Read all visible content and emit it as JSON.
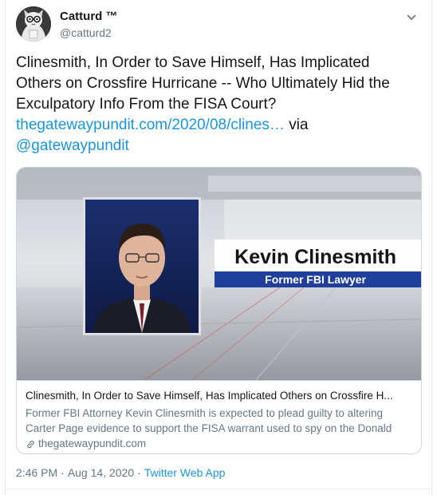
{
  "tweet": {
    "display_name": "Catturd ™",
    "handle": "@catturd2",
    "text_before": "Clinesmith, In Order to Save Himself, Has Implicated Others on Crossfire Hurricane -- Who Ultimately Hid the Exculpatory Info From the FISA Court? ",
    "link_text": "thegatewaypundit.com/2020/08/clines…",
    "via_text": " via ",
    "mention": "@gatewaypundit",
    "time": "2:46 PM",
    "date": "Aug 14, 2020",
    "source": "Twitter Web App",
    "separator": "·"
  },
  "card": {
    "image_name": "Kevin Clinesmith",
    "image_caption": "Former FBI Lawyer",
    "title": "Clinesmith, In Order to Save Himself, Has Implicated Others on Crossfire H...",
    "description": "Former FBI Attorney Kevin Clinesmith is expected to plead guilty to altering Carter Page evidence to support the FISA warrant used to spy on the Donald",
    "domain": "thegatewaypundit.com"
  },
  "colors": {
    "link": "#1b95e0",
    "secondary_text": "#657786",
    "banner_blue": "#1f3f9a"
  },
  "icons": [
    "chevron-down-icon",
    "link-icon",
    "avatar"
  ]
}
